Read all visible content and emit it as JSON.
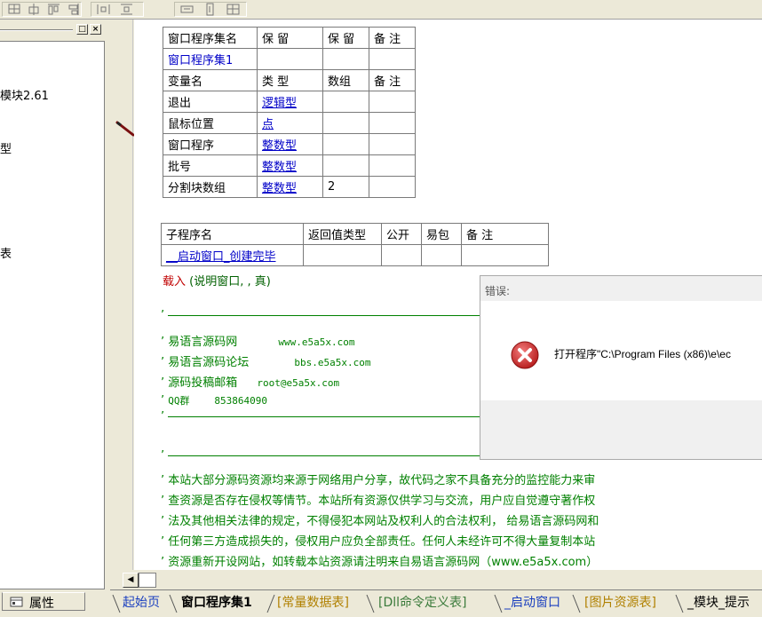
{
  "left_panel": {
    "tree_items": [
      "模块2.61",
      "型",
      "表"
    ]
  },
  "property_tab": {
    "label": "属性"
  },
  "program_set_table": {
    "headers": [
      "窗口程序集名",
      "保 留",
      "保 留",
      "备 注"
    ],
    "row": [
      "窗口程序集1",
      "",
      "",
      ""
    ]
  },
  "variable_table": {
    "headers": [
      "变量名",
      "类 型",
      "数组",
      "备 注"
    ],
    "rows": [
      [
        "退出",
        "逻辑型",
        "",
        ""
      ],
      [
        "鼠标位置",
        "点",
        "",
        ""
      ],
      [
        "窗口程序",
        "整数型",
        "",
        ""
      ],
      [
        "批号",
        "整数型",
        "",
        ""
      ],
      [
        "分割块数组",
        "整数型",
        "2",
        ""
      ]
    ]
  },
  "sub_table": {
    "headers": [
      "子程序名",
      "返回值类型",
      "公开",
      "易包",
      "备 注"
    ],
    "row": [
      "__启动窗口_创建完毕",
      "",
      "",
      "",
      ""
    ]
  },
  "code": {
    "load_keyword": "载入",
    "load_args": "(说明窗口, , 真)",
    "quote": "’",
    "info": [
      {
        "label": "易语言源码网",
        "value": "www.e5a5x.com"
      },
      {
        "label": "易语言源码论坛",
        "value": "bbs.e5a5x.com"
      },
      {
        "label": "源码投稿邮箱",
        "value": "root@e5a5x.com"
      },
      {
        "label": "QQ群",
        "value": "853864090"
      }
    ],
    "notice": [
      "本站大部分源码资源均来源于网络用户分享，故代码之家不具备充分的监控能力来审",
      "查资源是否存在侵权等情节。本站所有资源仅供学习与交流，用户应自觉遵守著作权",
      "法及其他相关法律的规定，不得侵犯本网站及权利人的合法权利， 给易语言源码网和",
      "任何第三方造成损失的，侵权用户应负全部责任。任何人未经许可不得大量复制本站",
      "资源重新开设网站，如转载本站资源请注明来自易语言源码网（www.e5a5x.com）"
    ]
  },
  "dialog": {
    "title": "错误:",
    "message": "打开程序\"C:\\Program Files (x86)\\e\\ec"
  },
  "bottom_tabs": [
    "起始页",
    "窗口程序集1",
    "[常量数据表]",
    "[Dll命令定义表]",
    "_启动窗口",
    "[图片资源表]",
    "_模块_提示"
  ],
  "colors": {
    "keyword": "#c00000",
    "type_link": "#0000c8",
    "comment": "#008000",
    "error_red": "#d92b2b"
  }
}
